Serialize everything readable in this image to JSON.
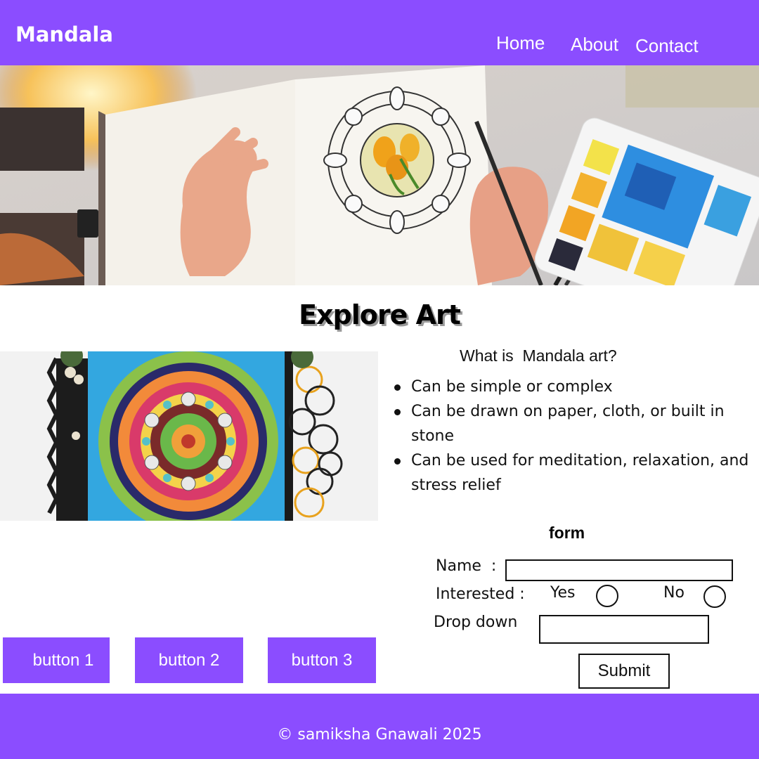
{
  "header": {
    "brand": "Mandala",
    "nav": {
      "home": "Home",
      "about": "About",
      "contact": "Contact"
    }
  },
  "main": {
    "title": "Explore Art",
    "info": {
      "heading": "What is  Mandala art?",
      "points": [
        "Can be simple or complex",
        "Can be drawn on paper, cloth, or built in stone",
        "Can be used for meditation, relaxation, and stress relief"
      ]
    }
  },
  "form": {
    "title": "form",
    "name_label": "Name  :",
    "name_value": "",
    "interest_label": "Interested :",
    "yes_label": "Yes",
    "no_label": "No",
    "dropdown_label": "Drop down",
    "dropdown_value": "",
    "submit_label": "Submit"
  },
  "buttons": {
    "button1": "button 1",
    "button2": "button 2",
    "button3": "button 3"
  },
  "footer": {
    "copyright": "© samiksha Gnawali 2025"
  },
  "colors": {
    "brand": "#8b4dff",
    "text": "#111111",
    "background": "#ffffff"
  }
}
